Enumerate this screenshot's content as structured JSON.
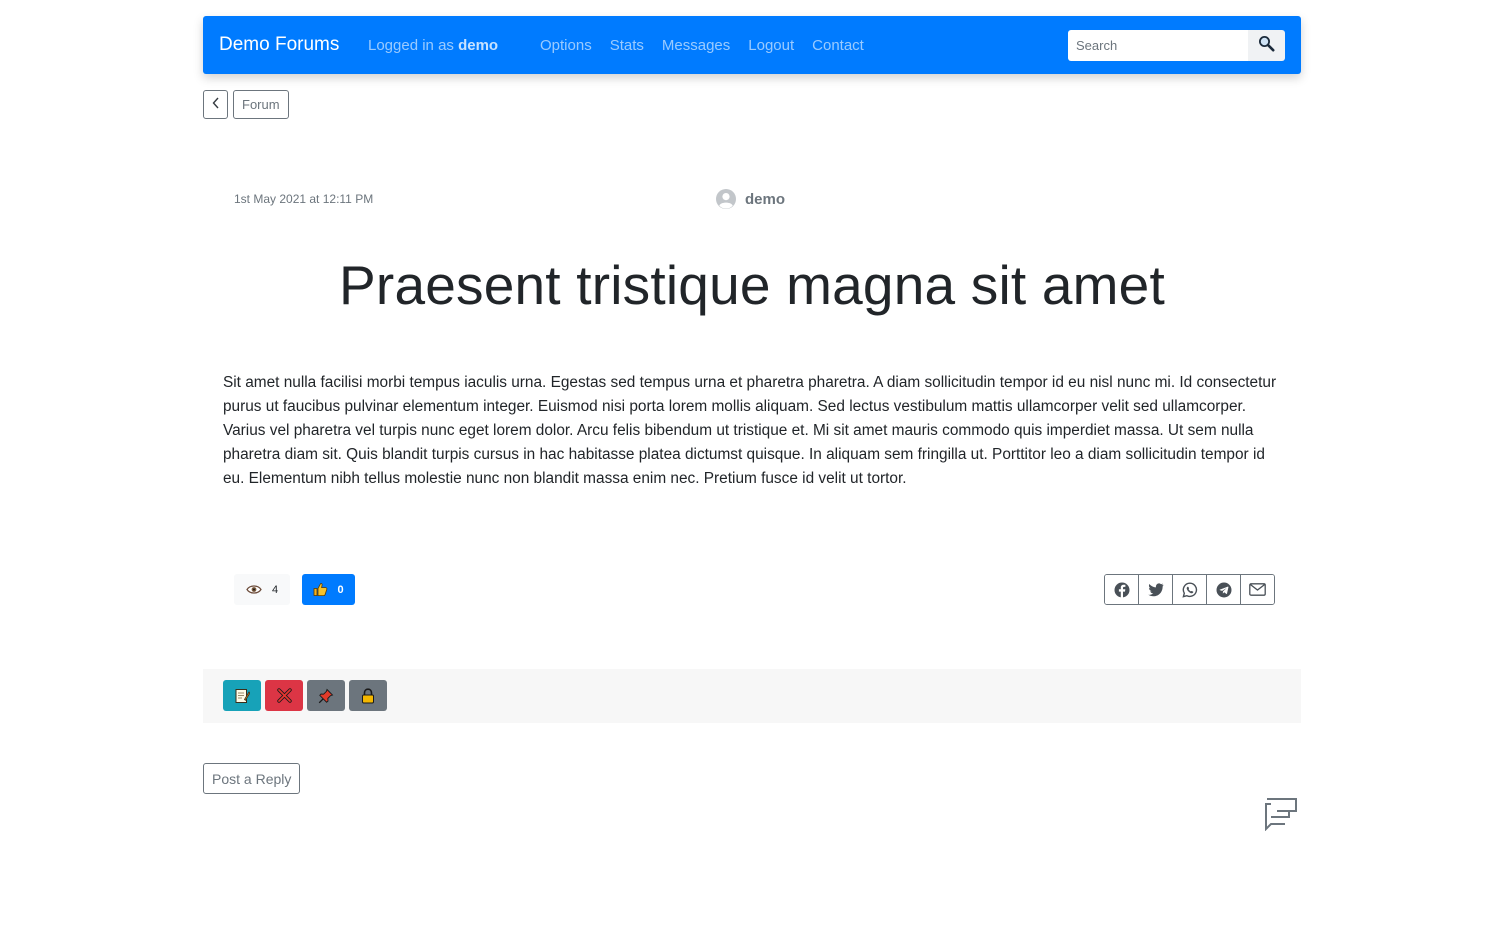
{
  "colors": {
    "primary": "#007bff",
    "secondary": "#6c757d",
    "info": "#17a2b8",
    "danger": "#dc3545",
    "light": "#f8f9fa"
  },
  "navbar": {
    "brand": "Demo Forums",
    "logged_prefix": "Logged in as",
    "username": "demo",
    "links": [
      "Options",
      "Stats",
      "Messages",
      "Logout",
      "Contact"
    ],
    "search_placeholder": "Search",
    "search_icon": "magnifier-icon"
  },
  "breadcrumb": {
    "back_icon": "chevron-left-icon",
    "forum_label": "Forum"
  },
  "post": {
    "date": "1st May 2021 at 12:11 PM",
    "author": "demo",
    "title": "Praesent tristique magna sit amet",
    "body": "Sit amet nulla facilisi morbi tempus iaculis urna. Egestas sed tempus urna et pharetra pharetra. A diam sollicitudin tempor id eu nisl nunc mi. Id consectetur purus ut faucibus pulvinar elementum integer. Euismod nisi porta lorem mollis aliquam. Sed lectus vestibulum mattis ullamcorper velit sed ullamcorper. Varius vel pharetra vel turpis nunc eget lorem dolor. Arcu felis bibendum ut tristique et. Mi sit amet mauris commodo quis imperdiet massa. Ut sem nulla pharetra diam sit. Quis blandit turpis cursus in hac habitasse platea dictumst quisque. In aliquam sem fringilla ut. Porttitor leo a diam sollicitudin tempor id eu. Elementum nibh tellus molestie nunc non blandit massa enim nec. Pretium fusce id velit ut tortor.",
    "views": "4",
    "likes": "0"
  },
  "share_icons": [
    "facebook-icon",
    "twitter-icon",
    "whatsapp-icon",
    "telegram-icon",
    "email-icon"
  ],
  "moderation_icons": [
    "edit-icon",
    "delete-icon",
    "pin-icon",
    "lock-icon"
  ],
  "reply_label": "Post a Reply"
}
